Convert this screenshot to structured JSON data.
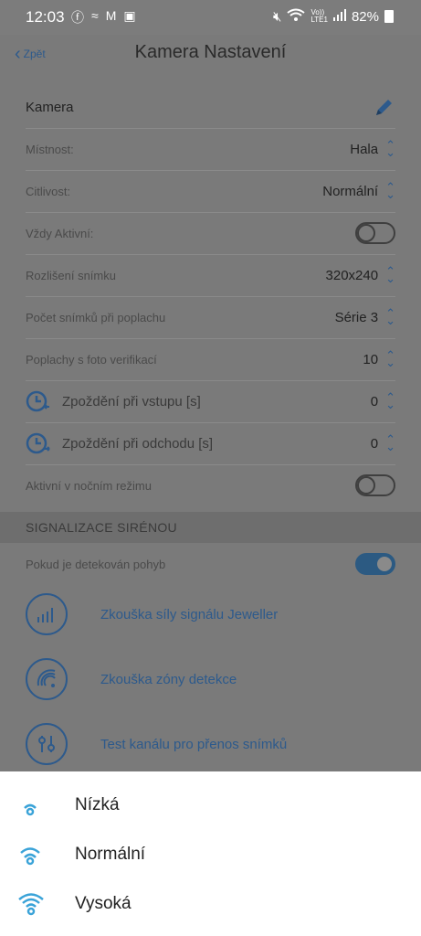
{
  "status_bar": {
    "time": "12:03",
    "left_icons": [
      "facebook-icon",
      "wave-icon",
      "gmail-icon",
      "image-icon"
    ],
    "right_icons": [
      "mute-icon",
      "wifi-icon",
      "volte-icon",
      "signal-icon"
    ],
    "volte_text": "Vo))\nLTE1",
    "battery": "82%"
  },
  "header": {
    "back_label": "Zpět",
    "title": "Kamera Nastavení"
  },
  "settings": {
    "name": "Kamera",
    "rows": [
      {
        "label": "Místnost:",
        "value": "Hala"
      },
      {
        "label": "Citlivost:",
        "value": "Normální"
      },
      {
        "label": "Vždy Aktivní:",
        "value": ""
      },
      {
        "label": "Rozlišení snímku",
        "value": "320x240"
      },
      {
        "label": "Počet snímků při poplachu",
        "value": "Série 3"
      },
      {
        "label": "Poplachy s foto verifikací",
        "value": "10"
      },
      {
        "label": "Zpoždění při vstupu [s]",
        "value": "0"
      },
      {
        "label": "Zpoždění při odchodu [s]",
        "value": "0"
      },
      {
        "label": "Aktivní v nočním režimu",
        "value": ""
      }
    ],
    "toggles": {
      "always_active": false,
      "night_mode": false,
      "motion_siren": true
    }
  },
  "siren_section": {
    "title": "SIGNALIZACE SIRÉNOU",
    "motion_label": "Pokud je detekován pohyb"
  },
  "tests": [
    {
      "label": "Zkouška síly signálu Jeweller",
      "icon": "signal-bars-icon"
    },
    {
      "label": "Zkouška zóny detekce",
      "icon": "detection-zone-icon"
    },
    {
      "label": "Test kanálu pro přenos snímků",
      "icon": "sliders-icon"
    }
  ],
  "sheet": {
    "options": [
      {
        "label": "Nízká",
        "icon": "sensitivity-low-icon"
      },
      {
        "label": "Normální",
        "icon": "sensitivity-normal-icon"
      },
      {
        "label": "Vysoká",
        "icon": "sensitivity-high-icon"
      }
    ]
  },
  "colors": {
    "accent": "#2d5a8c",
    "sheet_icon": "#3aa3d8",
    "overlay": "#7a7a7a"
  }
}
